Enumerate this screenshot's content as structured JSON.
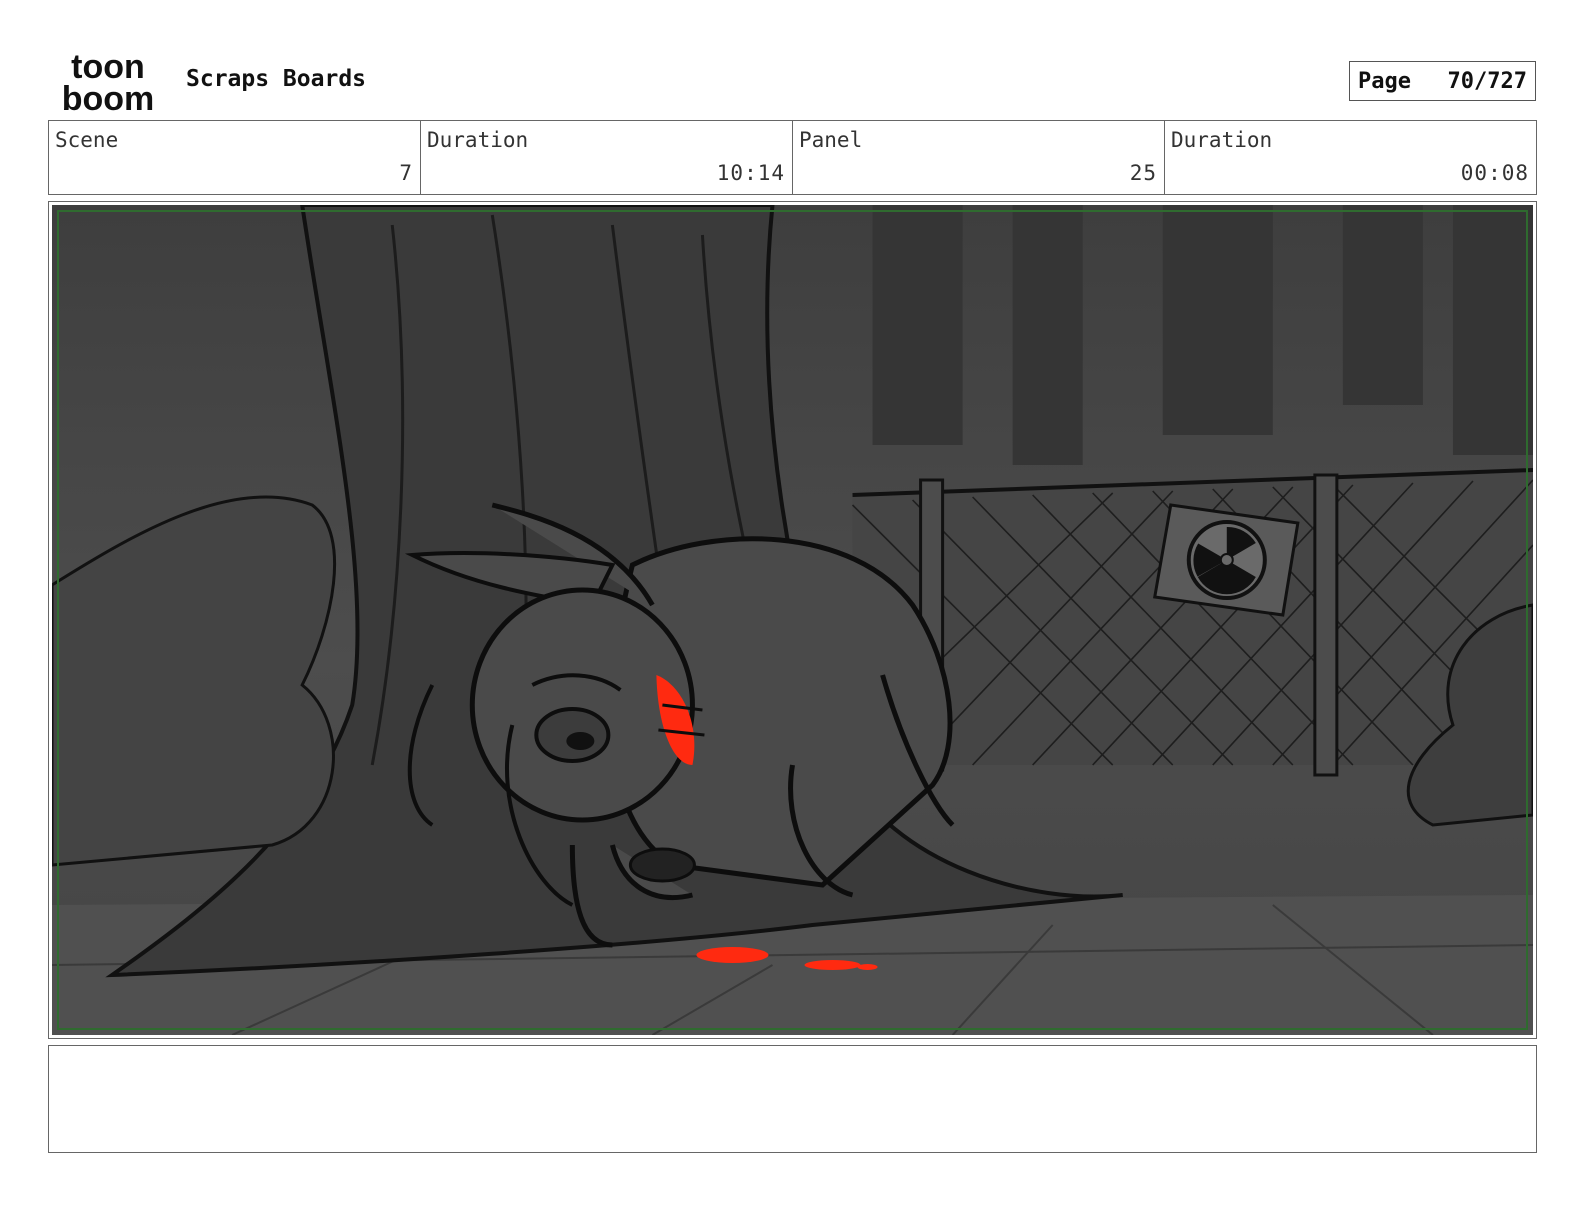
{
  "header": {
    "logo_line1": "toon",
    "logo_line2": "boom",
    "title": "Scraps Boards",
    "page_label": "Page",
    "page_number": "70/727"
  },
  "info": {
    "scene_label": "Scene",
    "scene_value": "7",
    "scene_duration_label": "Duration",
    "scene_duration_value": "10:14",
    "panel_label": "Panel",
    "panel_value": "25",
    "panel_duration_label": "Duration",
    "panel_duration_value": "00:08"
  },
  "panel": {
    "safe_frame_color": "#2f6b2f",
    "accent_color": "#ff2a10"
  },
  "notes": {
    "text": ""
  }
}
